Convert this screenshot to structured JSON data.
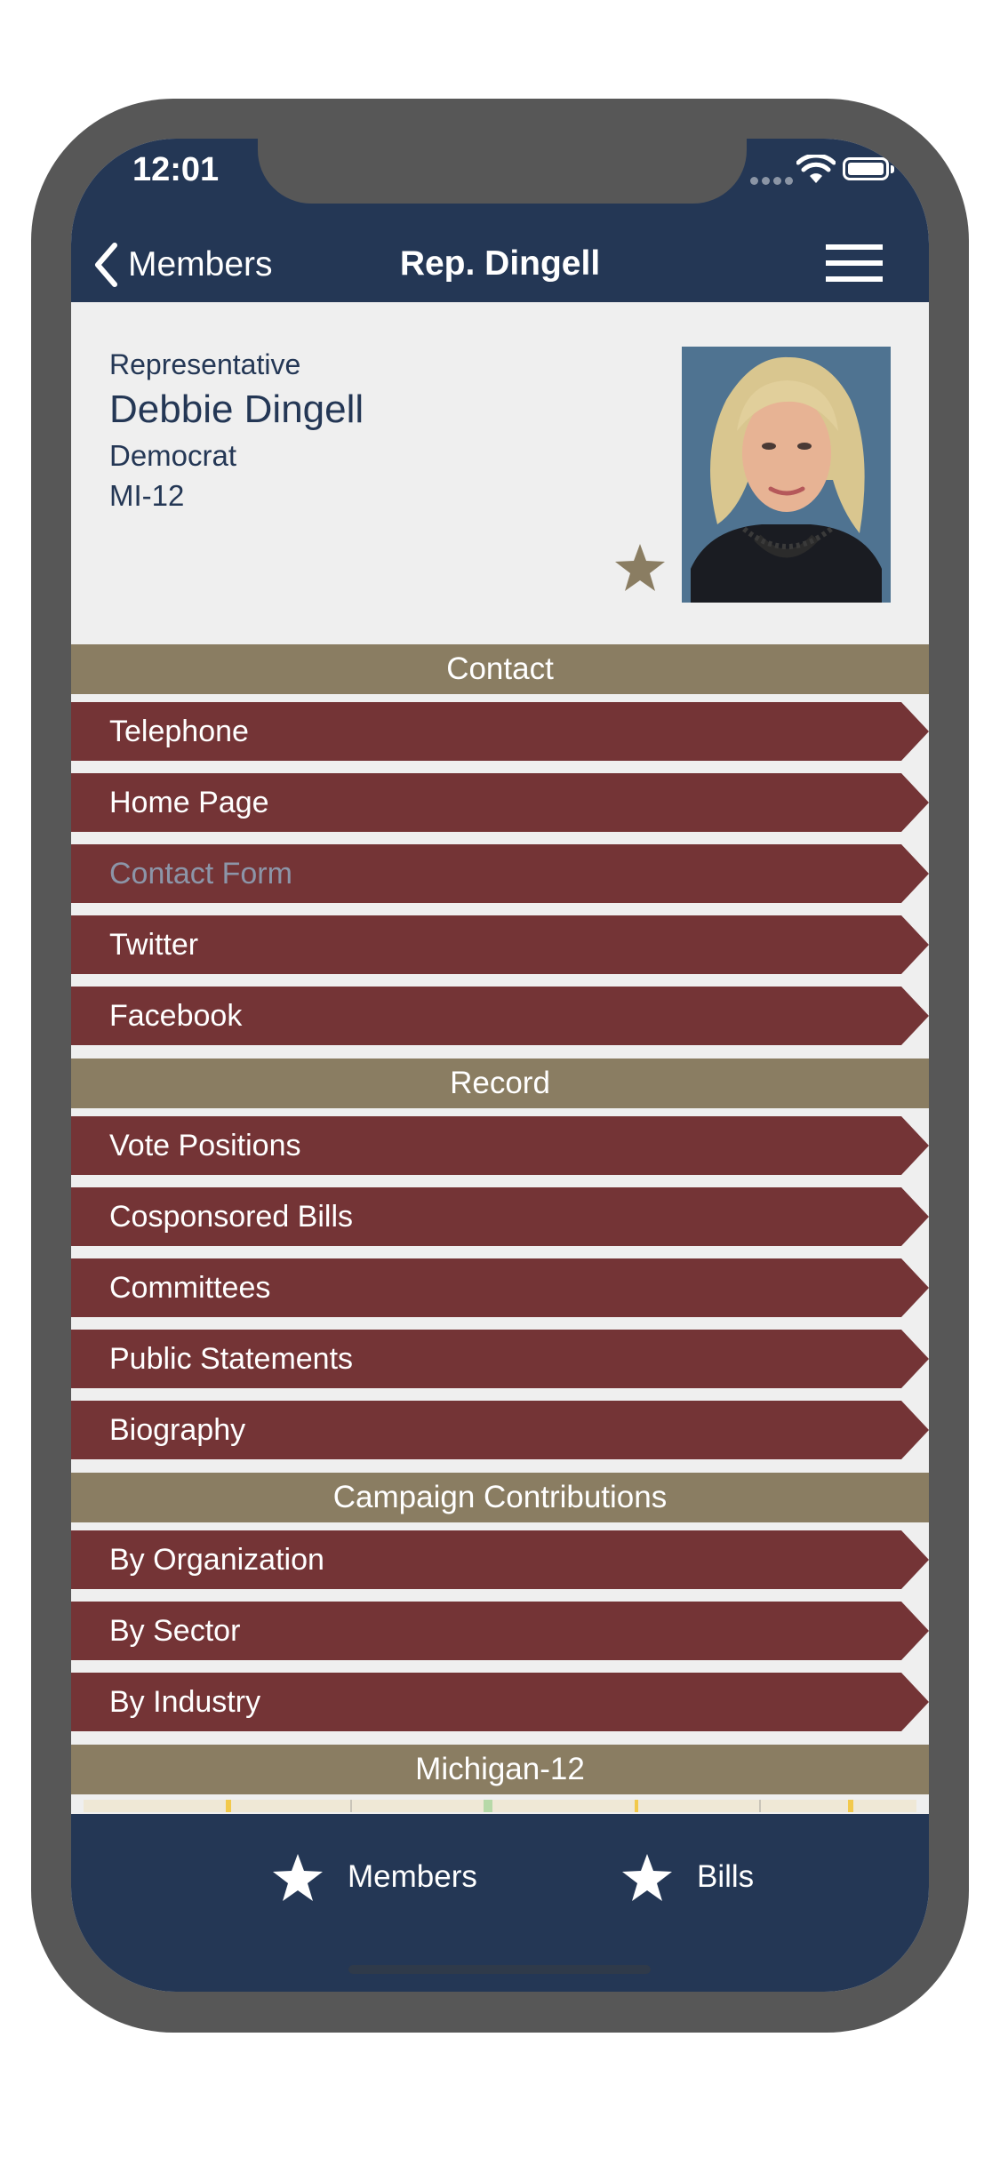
{
  "status_bar": {
    "time": "12:01"
  },
  "nav": {
    "back_label": "Members",
    "title": "Rep. Dingell",
    "menu_icon": "hamburger-icon"
  },
  "profile": {
    "role": "Representative",
    "name": "Debbie Dingell",
    "party": "Democrat",
    "district": "MI-12",
    "favorite_icon": "star-icon"
  },
  "sections": {
    "contact": {
      "header": "Contact",
      "items": [
        "Telephone",
        "Home Page",
        "Contact Form",
        "Twitter",
        "Facebook"
      ]
    },
    "record": {
      "header": "Record",
      "items": [
        "Vote Positions",
        "Cosponsored Bills",
        "Committees",
        "Public Statements",
        "Biography"
      ]
    },
    "contributions": {
      "header": "Campaign Contributions",
      "items": [
        "By Organization",
        "By Sector",
        "By Industry"
      ]
    },
    "map": {
      "header": "Michigan-12"
    }
  },
  "tab_bar": {
    "members_label": "Members",
    "bills_label": "Bills"
  },
  "colors": {
    "navy": "#243755",
    "section_header": "#8a7d62",
    "row_background": "#743436",
    "disabled_text": "#8c95a8"
  }
}
